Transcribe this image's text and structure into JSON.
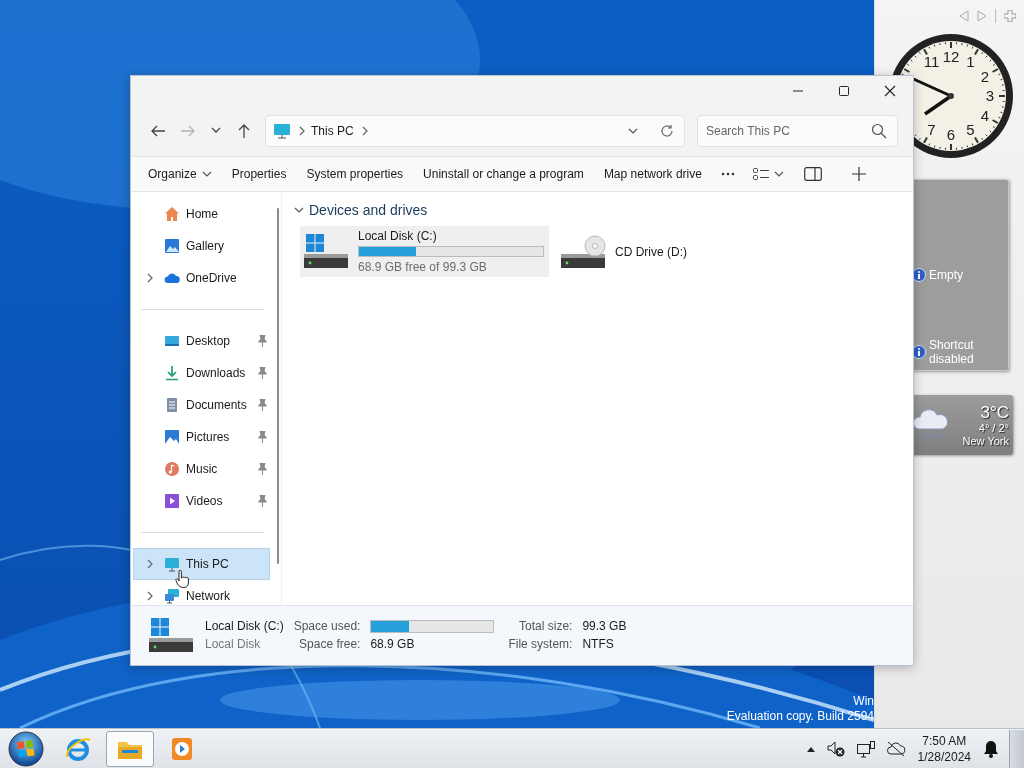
{
  "desktop": {
    "notice": [
      "Win",
      "Evaluation copy. Build 2594"
    ]
  },
  "gadgets": {
    "clock": {
      "numerals": [
        "11",
        "12",
        "1",
        "2",
        "3",
        "4",
        "5",
        "6",
        "7"
      ]
    },
    "slideshow": {
      "messages": [
        "Empty",
        "Shortcut disabled"
      ]
    },
    "weather": {
      "temperature": "3°C",
      "range": "4° / 2°",
      "city": "New York"
    }
  },
  "window": {
    "nav": [
      {
        "kind": "back",
        "disabled": false
      },
      {
        "kind": "forward",
        "disabled": true
      },
      {
        "kind": "recent",
        "disabled": false
      },
      {
        "kind": "up",
        "disabled": false
      }
    ],
    "address": {
      "location": "This PC"
    },
    "search": {
      "placeholder": "Search This PC"
    },
    "commands": [
      {
        "label": "Organize",
        "kind": "menu"
      },
      {
        "label": "Properties",
        "kind": "plain"
      },
      {
        "label": "System properties",
        "kind": "plain"
      },
      {
        "label": "Uninstall or change a program",
        "kind": "plain"
      },
      {
        "label": "Map network drive",
        "kind": "plain"
      }
    ],
    "sidebar": {
      "sections": [
        {
          "items": [
            {
              "label": "Home",
              "kind": "home",
              "expandable": false,
              "pinned": false,
              "selected": false
            },
            {
              "label": "Gallery",
              "kind": "gallery",
              "expandable": false,
              "pinned": false,
              "selected": false
            },
            {
              "label": "OneDrive",
              "kind": "cloud",
              "expandable": true,
              "pinned": false,
              "selected": false
            }
          ]
        },
        {
          "items": [
            {
              "label": "Desktop",
              "kind": "desktop",
              "expandable": false,
              "pinned": true,
              "selected": false
            },
            {
              "label": "Downloads",
              "kind": "downloads",
              "expandable": false,
              "pinned": true,
              "selected": false
            },
            {
              "label": "Documents",
              "kind": "documents",
              "expandable": false,
              "pinned": true,
              "selected": false
            },
            {
              "label": "Pictures",
              "kind": "pictures",
              "expandable": false,
              "pinned": true,
              "selected": false
            },
            {
              "label": "Music",
              "kind": "music",
              "expandable": false,
              "pinned": true,
              "selected": false
            },
            {
              "label": "Videos",
              "kind": "videos",
              "expandable": false,
              "pinned": true,
              "selected": false
            }
          ]
        },
        {
          "items": [
            {
              "label": "This PC",
              "kind": "pc",
              "expandable": true,
              "pinned": false,
              "selected": true
            },
            {
              "label": "Network",
              "kind": "network",
              "expandable": true,
              "pinned": false,
              "selected": false
            }
          ]
        }
      ]
    },
    "content": {
      "group": {
        "title": "Devices and drives",
        "expanded": true
      },
      "drives": [
        {
          "name": "Local Disk (C:)",
          "kind": "disk",
          "level": 0.31,
          "free_text": "68.9 GB free of 99.3 GB",
          "selected": true
        },
        {
          "name": "CD Drive (D:)",
          "kind": "cd",
          "selected": false
        }
      ]
    },
    "details": {
      "title": "Local Disk (C:)",
      "subtitle": "Local Disk",
      "fields": [
        {
          "label": "Space used:",
          "kind": "bar",
          "level": 0.31
        },
        {
          "label": "Total size:",
          "kind": "text",
          "value": "99.3 GB"
        },
        {
          "label": "Space free:",
          "kind": "text",
          "value": "68.9 GB"
        },
        {
          "label": "File system:",
          "kind": "text",
          "value": "NTFS"
        }
      ]
    }
  },
  "taskbar": {
    "apps": [
      {
        "kind": "browser",
        "selected": false
      },
      {
        "kind": "explorer",
        "selected": true
      },
      {
        "kind": "media",
        "selected": false
      }
    ],
    "time": "7:50 AM",
    "date": "1/28/2024"
  }
}
